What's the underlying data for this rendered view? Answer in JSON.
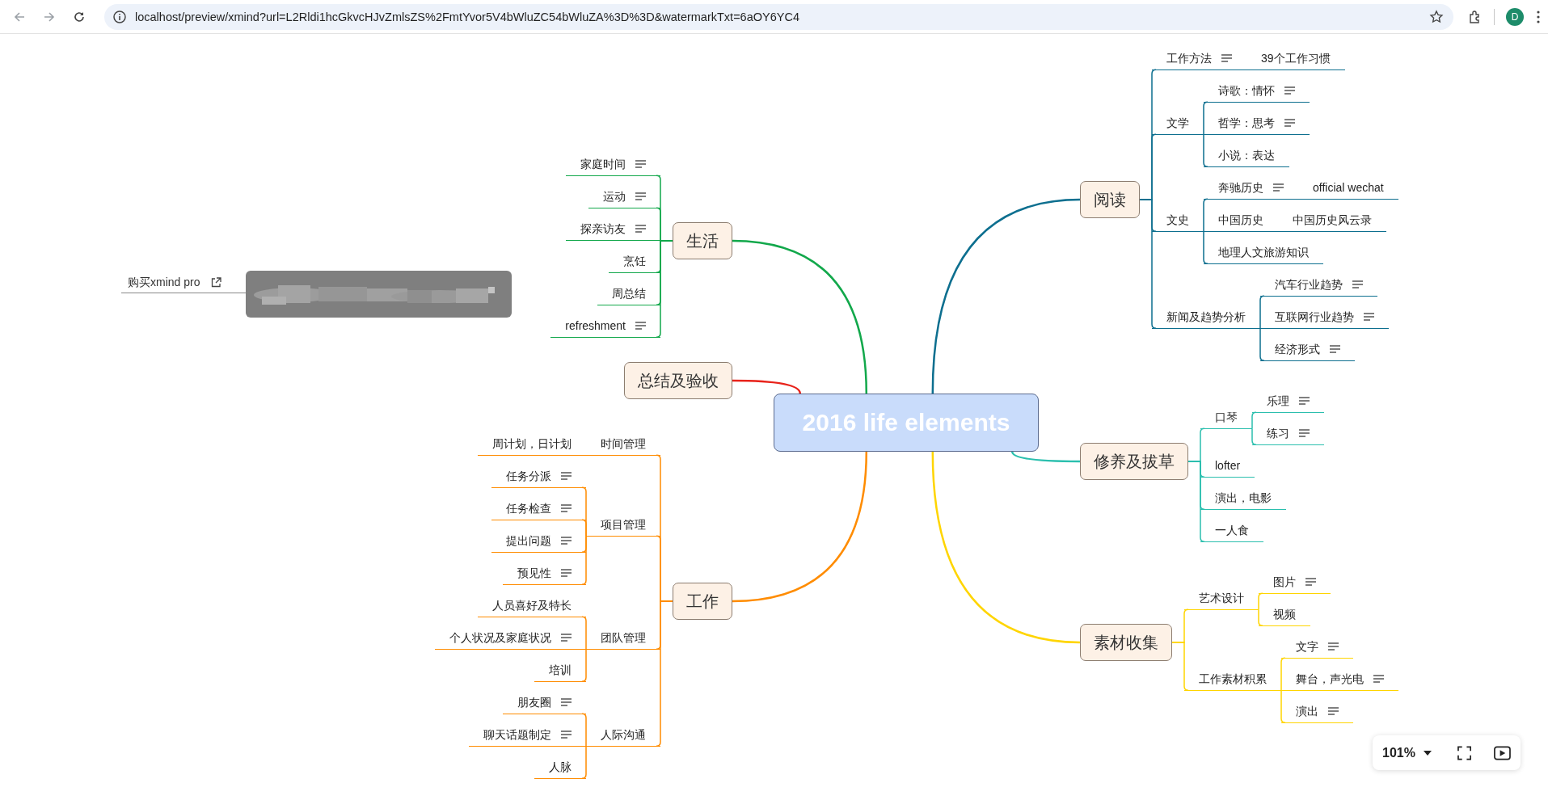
{
  "browser": {
    "url": "localhost/preview/xmind?url=L2Rldi1hcGkvcHJvZmlsZS%2FmtYvor5V4bWluZC54bWluZA%3D%3D&watermarkTxt=6aOY6YC4",
    "avatar": "D"
  },
  "promo": {
    "link": "购买xmind pro"
  },
  "mindmap": {
    "central": "2016 life elements",
    "left": [
      {
        "text": "生活",
        "color": "#12a84b",
        "children": [
          {
            "text": "家庭时间",
            "note": true
          },
          {
            "text": "运动",
            "note": true
          },
          {
            "text": "探亲访友",
            "note": true
          },
          {
            "text": "烹饪",
            "note": false
          },
          {
            "text": "周总结",
            "note": false
          },
          {
            "text": "refreshment",
            "note": true
          }
        ]
      },
      {
        "text": "总结及验收",
        "color": "#e8231b"
      },
      {
        "text": "工作",
        "color": "#ff8c00",
        "children": [
          {
            "text": "时间管理",
            "note": false,
            "children": [
              {
                "text": "周计划，日计划",
                "note": false
              }
            ]
          },
          {
            "text": "项目管理",
            "note": false,
            "children": [
              {
                "text": "任务分派",
                "note": true
              },
              {
                "text": "任务检查",
                "note": true
              },
              {
                "text": "提出问题",
                "note": true
              },
              {
                "text": "预见性",
                "note": true
              }
            ]
          },
          {
            "text": "团队管理",
            "note": false,
            "children": [
              {
                "text": "人员喜好及特长",
                "note": false
              },
              {
                "text": "个人状况及家庭状况",
                "note": true
              },
              {
                "text": "培训",
                "note": false
              }
            ]
          },
          {
            "text": "人际沟通",
            "note": false,
            "children": [
              {
                "text": "朋友圈",
                "note": true
              },
              {
                "text": "聊天话题制定",
                "note": true
              },
              {
                "text": "人脉",
                "note": false
              }
            ]
          }
        ]
      }
    ],
    "right": [
      {
        "text": "阅读",
        "color": "#0d6f8f",
        "children": [
          {
            "text": "工作方法",
            "note": true,
            "children": [
              {
                "text": "39个工作习惯",
                "note": false
              }
            ]
          },
          {
            "text": "文学",
            "note": false,
            "children": [
              {
                "text": "诗歌：情怀",
                "note": true
              },
              {
                "text": "哲学：思考",
                "note": true
              },
              {
                "text": "小说：表达",
                "note": false
              }
            ]
          },
          {
            "text": "文史",
            "note": false,
            "children": [
              {
                "text": "奔驰历史",
                "note": true,
                "children": [
                  {
                    "text": "official wechat",
                    "note": false
                  }
                ]
              },
              {
                "text": "中国历史",
                "note": false,
                "children": [
                  {
                    "text": "中国历史风云录",
                    "note": false
                  }
                ]
              },
              {
                "text": "地理人文旅游知识",
                "note": false
              }
            ]
          },
          {
            "text": "新闻及趋势分析",
            "note": false,
            "children": [
              {
                "text": "汽车行业趋势",
                "note": true
              },
              {
                "text": "互联网行业趋势",
                "note": true
              },
              {
                "text": "经济形式",
                "note": true
              }
            ]
          }
        ]
      },
      {
        "text": "修养及拔草",
        "color": "#2bbfae",
        "children": [
          {
            "text": "口琴",
            "note": false,
            "children": [
              {
                "text": "乐理",
                "note": true
              },
              {
                "text": "练习",
                "note": true
              }
            ]
          },
          {
            "text": "lofter",
            "note": false
          },
          {
            "text": "演出，电影",
            "note": false
          },
          {
            "text": "一人食",
            "note": false
          }
        ]
      },
      {
        "text": "素材收集",
        "color": "#ffd500",
        "children": [
          {
            "text": "艺术设计",
            "note": false,
            "children": [
              {
                "text": "图片",
                "note": true
              },
              {
                "text": "视频",
                "note": false
              }
            ]
          },
          {
            "text": "工作素材积累",
            "note": false,
            "children": [
              {
                "text": "文字",
                "note": true
              },
              {
                "text": "舞台，声光电",
                "note": true
              },
              {
                "text": "演出",
                "note": true
              }
            ]
          }
        ]
      }
    ]
  },
  "zoom": {
    "level": "101%"
  }
}
